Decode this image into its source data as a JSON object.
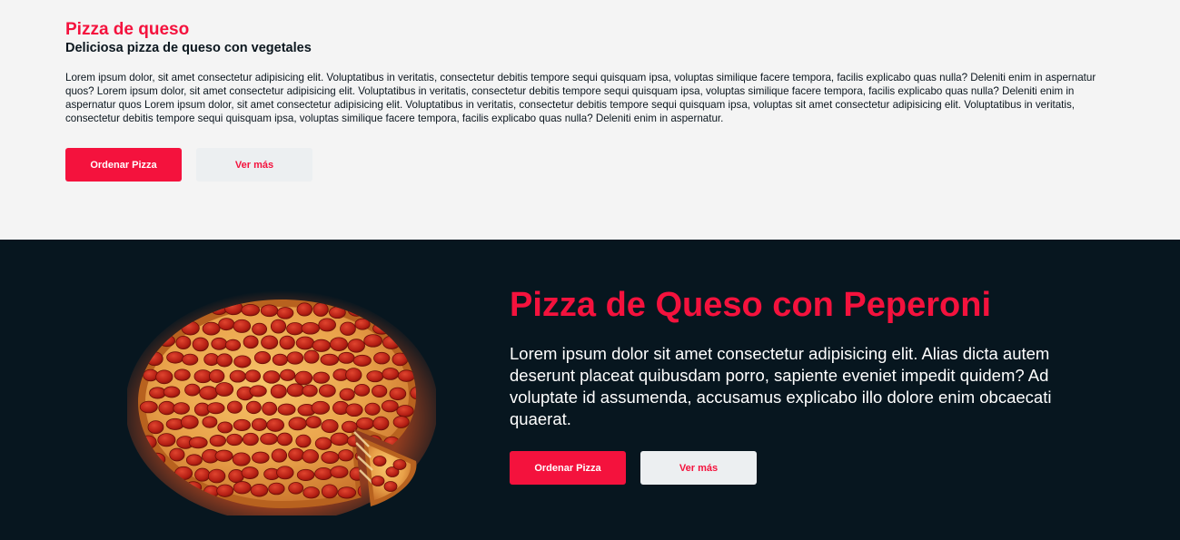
{
  "top": {
    "title": "Pizza de queso",
    "subtitle": "Deliciosa pizza de queso con vegetales",
    "body": "Lorem ipsum dolor, sit amet consectetur adipisicing elit. Voluptatibus in veritatis, consectetur debitis tempore sequi quisquam ipsa, voluptas similique facere tempora, facilis explicabo quas nulla? Deleniti enim in aspernatur quos? Lorem ipsum dolor, sit amet consectetur adipisicing elit. Voluptatibus in veritatis, consectetur debitis tempore sequi quisquam ipsa, voluptas similique facere tempora, facilis explicabo quas nulla? Deleniti enim in aspernatur quos Lorem ipsum dolor, sit amet consectetur adipisicing elit. Voluptatibus in veritatis, consectetur debitis tempore sequi quisquam ipsa, voluptas sit amet consectetur adipisicing elit. Voluptatibus in veritatis, consectetur debitis tempore sequi quisquam ipsa, voluptas similique facere tempora, facilis explicabo quas nulla? Deleniti enim in aspernatur.",
    "order_label": "Ordenar Pizza",
    "more_label": "Ver más"
  },
  "bottom": {
    "title": "Pizza de Queso con Peperoni",
    "body": "Lorem ipsum dolor sit amet consectetur adipisicing elit. Alias dicta autem deserunt placeat quibusdam porro, sapiente eveniet impedit quidem? Ad voluptate id assumenda, accusamus explicabo illo dolore enim obcaecati quaerat.",
    "order_label": "Ordenar Pizza",
    "more_label": "Ver más"
  },
  "colors": {
    "accent": "#f4123d",
    "dark_bg": "#07161f",
    "light_bg": "#f4f4f4",
    "secondary_button_bg": "#eceff1"
  },
  "icons": {
    "pizza_image": "pepperoni-pizza-image"
  }
}
